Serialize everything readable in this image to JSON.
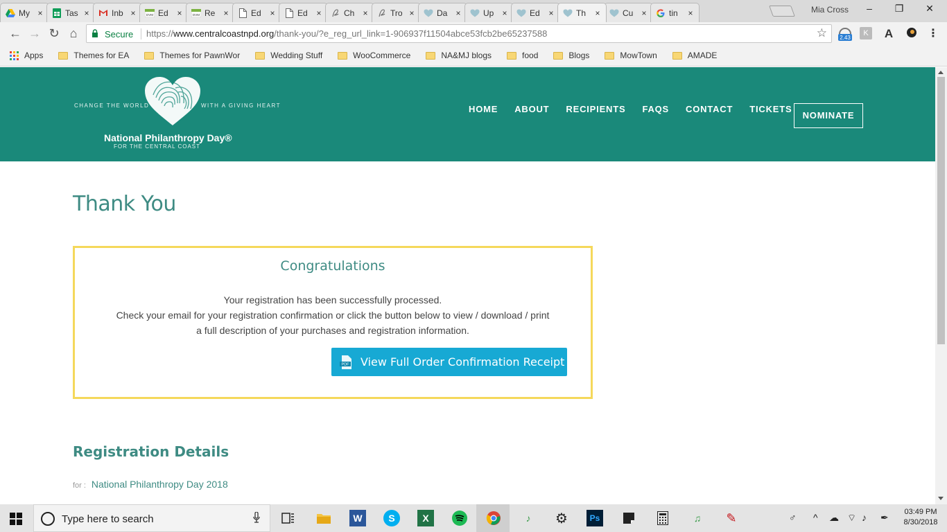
{
  "browser": {
    "tabs": [
      {
        "label": "My",
        "icon": "google-drive-icon"
      },
      {
        "label": "Tas",
        "icon": "google-sheets-icon"
      },
      {
        "label": "Inb",
        "icon": "gmail-icon"
      },
      {
        "label": "Ed",
        "icon": "dvm-icon"
      },
      {
        "label": "Re",
        "icon": "dvm-icon"
      },
      {
        "label": "Ed",
        "icon": "document-icon"
      },
      {
        "label": "Ed",
        "icon": "document-icon"
      },
      {
        "label": "Ch",
        "icon": "cursive-icon"
      },
      {
        "label": "Tro",
        "icon": "cursive-icon"
      },
      {
        "label": "Da",
        "icon": "heart-icon"
      },
      {
        "label": "Up",
        "icon": "heart-icon"
      },
      {
        "label": "Ed",
        "icon": "heart-icon"
      },
      {
        "label": "Th",
        "icon": "heart-icon",
        "active": true
      },
      {
        "label": "Cu",
        "icon": "heart-icon"
      },
      {
        "label": "tin",
        "icon": "google-icon"
      }
    ],
    "tab_close": "×",
    "profile_name": "Mia Cross",
    "window_controls": {
      "minimize": "–",
      "maximize": "❐",
      "close": "✕"
    },
    "nav": {
      "back": "←",
      "forward": "→",
      "reload": "↻",
      "home": "⌂"
    },
    "secure_label": "Secure",
    "url_prefix": "https://",
    "url_host": "www.centralcoastnpd.org",
    "url_path": "/thank-you/?e_reg_url_link=1-906937f11504abce53fcb2be65237588",
    "bookmark_star": "☆",
    "extension_badge": "2.43",
    "bookmarks": {
      "apps_label": "Apps",
      "folders": [
        "Themes for EA",
        "Themes for PawnWor",
        "Wedding Stuff",
        "WooCommerce",
        "NA&MJ blogs",
        "food",
        "Blogs",
        "MowTown",
        "AMADE"
      ]
    }
  },
  "site": {
    "logo": {
      "tagline_left": "CHANGE THE WORLD",
      "tagline_right": "WITH A GIVING HEART",
      "name": "National Philanthropy Day®",
      "subtitle": "FOR THE CENTRAL COAST"
    },
    "nav": [
      "HOME",
      "ABOUT",
      "RECIPIENTS",
      "FAQS",
      "CONTACT",
      "TICKETS"
    ],
    "nominate_label": "NOMINATE",
    "page_title": "Thank You",
    "congrats": {
      "title": "Congratulations",
      "line1": "Your registration has been successfully processed.",
      "line2": "Check your email for your registration confirmation or click the button below to view / download / print",
      "line3": "a full description of your purchases and registration information.",
      "button_label": "View Full Order Confirmation Receipt",
      "button_icon_text": "PDF"
    },
    "registration": {
      "title": "Registration Details",
      "for_label": "for :",
      "event_name": "National Philanthropy Day 2018"
    }
  },
  "taskbar": {
    "search_placeholder": "Type here to search",
    "clock_time": "03:49 PM",
    "clock_date": "8/30/2018"
  },
  "colors": {
    "header_teal": "#1a897a",
    "heading_teal": "#3e8b83",
    "box_border": "#f5d85b",
    "button_blue": "#17a9d4"
  }
}
